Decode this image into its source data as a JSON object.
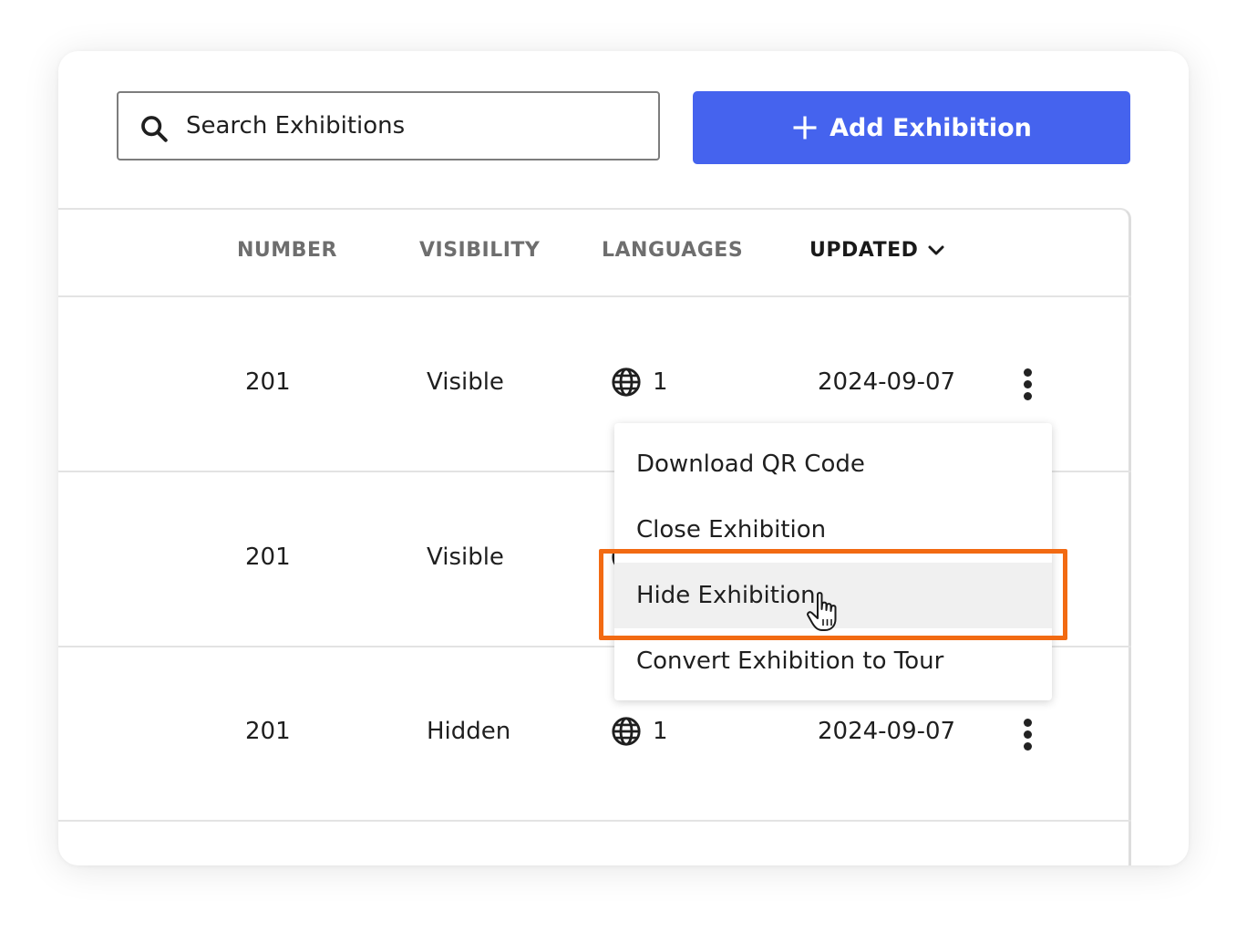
{
  "search": {
    "placeholder": "Search Exhibitions",
    "icon": "search-icon"
  },
  "add_button": {
    "label": "Add Exhibition",
    "icon": "plus-icon",
    "color": "#4563ee"
  },
  "table": {
    "columns": [
      {
        "label": "NUMBER"
      },
      {
        "label": "VISIBILITY"
      },
      {
        "label": "LANGUAGES"
      },
      {
        "label": "UPDATED",
        "sorted": true,
        "sort_icon": "chevron-down-icon"
      }
    ],
    "rows": [
      {
        "number": "201",
        "visibility": "Visible",
        "languages": "1",
        "updated": "2024-09-07"
      },
      {
        "number": "201",
        "visibility": "Visible",
        "languages": "",
        "updated": ""
      },
      {
        "number": "201",
        "visibility": "Hidden",
        "languages": "1",
        "updated": "2024-09-07"
      }
    ]
  },
  "context_menu": {
    "items": [
      {
        "label": "Download QR Code"
      },
      {
        "label": "Close Exhibition"
      },
      {
        "label": "Hide Exhibition",
        "hovered": true
      },
      {
        "label": "Convert Exhibition to Tour"
      }
    ]
  },
  "highlight_color": "#f26a12"
}
